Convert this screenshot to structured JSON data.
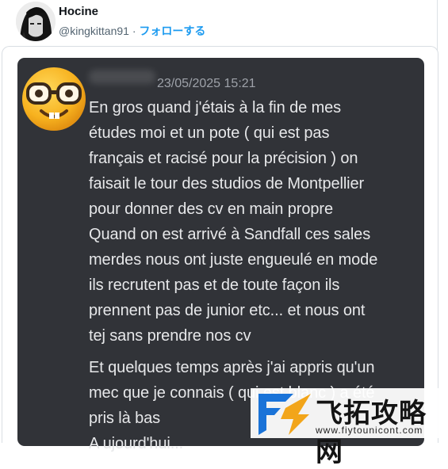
{
  "author": {
    "name": "Hocine",
    "handle": "@kingkittan91",
    "separator": " · ",
    "follow_label": "フォローする"
  },
  "discord_message": {
    "timestamp": "23/05/2025 15:21",
    "avatar_icon": "nerd-face-emoji",
    "paragraphs": [
      "En gros quand j'étais à la fin de mes\nétudes moi et un pote ( qui est pas\nfrançais et racisé pour la précision ) on\nfaisait le tour des studios de Montpellier\npour donner des cv en main propre\nQuand on est arrivé à Sandfall ces sales\nmerdes nous ont juste engueulé en mode\nils recrutent pas et de toute façon ils\nprennent pas de junior etc... et nous ont\ntej sans prendre nos cv",
      "Et quelques temps après j'ai appris qu'un\nmec que je connais ( qui est blanc ) a été\npris là bas\nA ujourd'hui..."
    ]
  },
  "watermark": {
    "text": "飞拓攻略网",
    "url": "www.fiytounicont.com"
  },
  "colors": {
    "card_bg": "#313338",
    "follow_blue": "#1d9bf0",
    "message_text": "#e7e8ea",
    "timestamp_text": "#9ea2a9"
  }
}
